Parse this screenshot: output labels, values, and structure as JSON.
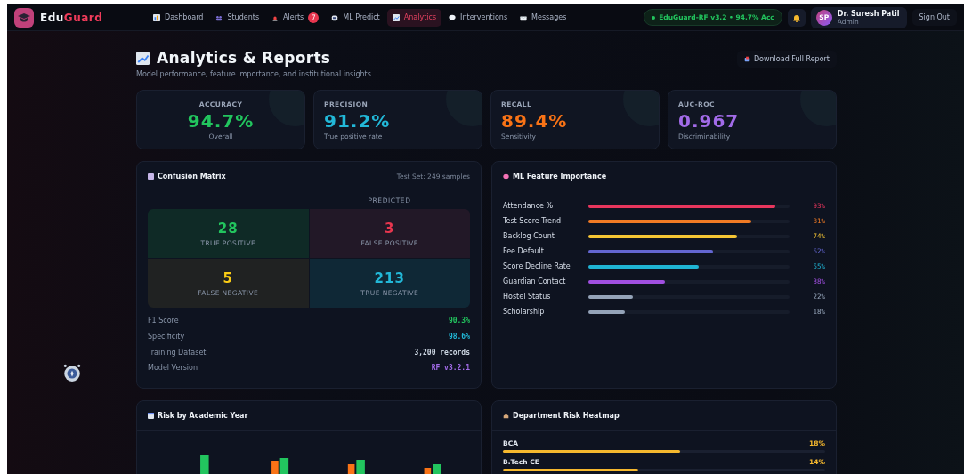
{
  "brand": {
    "part_1": "Edu",
    "part_2": "Guard"
  },
  "nav": [
    {
      "label": "Dashboard",
      "kind": "chart",
      "selected": false
    },
    {
      "label": "Students",
      "kind": "people",
      "selected": false
    },
    {
      "label": "Alerts",
      "kind": "siren",
      "selected": false,
      "badge": "7"
    },
    {
      "label": "ML Predict",
      "kind": "robot",
      "selected": false
    },
    {
      "label": "Analytics",
      "kind": "trend",
      "selected": true
    },
    {
      "label": "Interventions",
      "kind": "speech",
      "selected": false
    },
    {
      "label": "Messages",
      "kind": "mail",
      "selected": false
    }
  ],
  "model_status": "EduGuard-RF v3.2 • 94.7% Acc",
  "user": {
    "initials": "SP",
    "name": "Dr. Suresh Patil",
    "role": "Admin"
  },
  "sign_out": "Sign Out",
  "page": {
    "title": "Analytics & Reports",
    "subtitle": "Model performance, feature importance, and institutional insights",
    "download": "Download Full Report"
  },
  "metrics": [
    {
      "label": "ACCURACY",
      "value": "94.7%",
      "caption": "Overall",
      "color": "#22c55e"
    },
    {
      "label": "PRECISION",
      "value": "91.2%",
      "caption": "True positive rate",
      "color": "#22b8d8"
    },
    {
      "label": "RECALL",
      "value": "89.4%",
      "caption": "Sensitivity",
      "color": "#f97316"
    },
    {
      "label": "AUC-ROC",
      "value": "0.967",
      "caption": "Discriminability",
      "color": "#a26be8"
    }
  ],
  "confusion_matrix": {
    "title": "Confusion Matrix",
    "note": "Test Set: 249 samples",
    "axis_label": "PREDICTED",
    "cells": [
      {
        "kind": "tp",
        "value": "28",
        "label": "TRUE POSITIVE"
      },
      {
        "kind": "fp",
        "value": "3",
        "label": "FALSE POSITIVE"
      },
      {
        "kind": "fn",
        "value": "5",
        "label": "FALSE NEGATIVE"
      },
      {
        "kind": "tn",
        "value": "213",
        "label": "TRUE NEGATIVE"
      }
    ],
    "stats": [
      {
        "label": "F1 Score",
        "value": "90.3%",
        "color": "#22c55e"
      },
      {
        "label": "Specificity",
        "value": "98.6%",
        "color": "#22b8d8"
      },
      {
        "label": "Training Dataset",
        "value": "3,200 records",
        "color": "#cbd5e1"
      },
      {
        "label": "Model Version",
        "value": "RF v3.2.1",
        "color": "#a26be8"
      }
    ]
  },
  "feature_importance": {
    "title": "ML Feature Importance",
    "features": [
      {
        "name": "Attendance %",
        "level": 0.93,
        "reading": "93%",
        "color": "#e8365d"
      },
      {
        "name": "Test Score Trend",
        "level": 0.81,
        "reading": "81%",
        "color": "#f07a24"
      },
      {
        "name": "Backlog Count",
        "level": 0.74,
        "reading": "74%",
        "color": "#f5c534"
      },
      {
        "name": "Fee Default",
        "level": 0.62,
        "reading": "62%",
        "color": "#6366d1"
      },
      {
        "name": "Score Decline Rate",
        "level": 0.55,
        "reading": "55%",
        "color": "#1fb4d4"
      },
      {
        "name": "Guardian Contact",
        "level": 0.38,
        "reading": "38%",
        "color": "#a04fe0"
      },
      {
        "name": "Hostel Status",
        "level": 0.22,
        "reading": "22%",
        "color": "#94a3b8"
      },
      {
        "name": "Scholarship",
        "level": 0.18,
        "reading": "18%",
        "color": "#94a3b8"
      }
    ]
  },
  "risk_by_year": {
    "title": "Risk by Academic Year"
  },
  "heatmap": {
    "title": "Department Risk Heatmap",
    "departments": [
      {
        "name": "BCA",
        "reading": "18%",
        "level": 0.55
      },
      {
        "name": "B.Tech CE",
        "reading": "14%",
        "level": 0.42
      }
    ]
  }
}
